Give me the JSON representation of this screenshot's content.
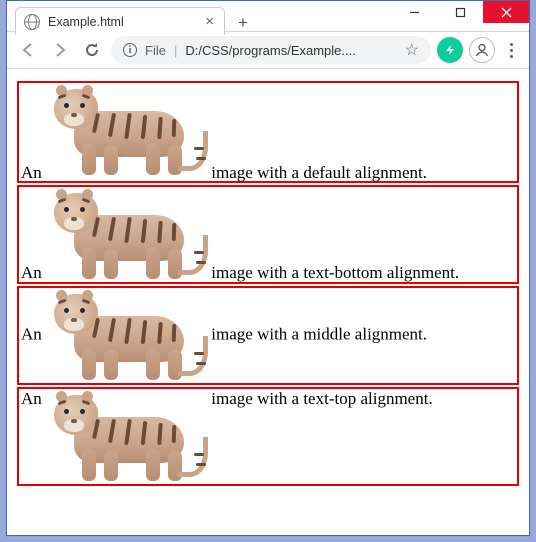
{
  "window": {
    "tab_title": "Example.html",
    "address_label": "File",
    "address_path": "D:/CSS/programs/Example....",
    "new_tab_glyph": "+",
    "close_tab_glyph": "×",
    "star_glyph": "☆"
  },
  "content": {
    "rows": [
      {
        "prefix": "An",
        "suffix": "image with a default alignment.",
        "valign": "va-baseline"
      },
      {
        "prefix": "An",
        "suffix": "image with a text-bottom alignment.",
        "valign": "va-textbottom"
      },
      {
        "prefix": "An",
        "suffix": "image with a middle alignment.",
        "valign": "va-middle"
      },
      {
        "prefix": "An",
        "suffix": "image with a text-top alignment.",
        "valign": "va-texttop"
      }
    ]
  }
}
